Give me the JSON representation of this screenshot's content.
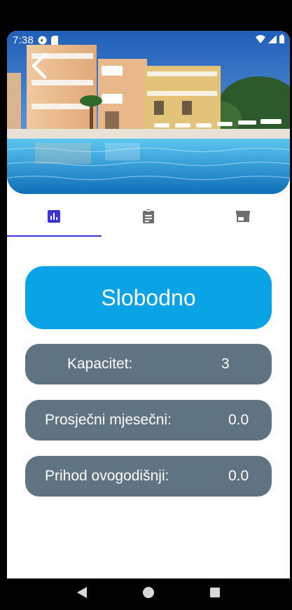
{
  "status_bar": {
    "time": "7:38",
    "icons": [
      "sync-icon",
      "sim-card-icon",
      "wifi-icon",
      "signal-icon",
      "battery-icon"
    ]
  },
  "hero": {
    "image": "hotel-pool-photo",
    "back_icon": "chevron-left-icon"
  },
  "tabs": [
    {
      "icon": "bar-chart-icon",
      "selected": true
    },
    {
      "icon": "clipboard-icon",
      "selected": false
    },
    {
      "icon": "storefront-icon",
      "selected": false
    }
  ],
  "status": {
    "label": "Slobodno",
    "color": "#0aa3e6"
  },
  "stats": [
    {
      "label": "Kapacitet:",
      "value": "3"
    },
    {
      "label": "Prosječni mjesečni:",
      "value": "0.0"
    },
    {
      "label": "Prihod ovogodišnji:",
      "value": "0.0"
    }
  ],
  "nav_bar": {
    "buttons": [
      "back-triangle-icon",
      "home-circle-icon",
      "recents-square-icon"
    ]
  },
  "colors": {
    "accent": "#3b35d4",
    "row_bg": "#5f7480"
  }
}
